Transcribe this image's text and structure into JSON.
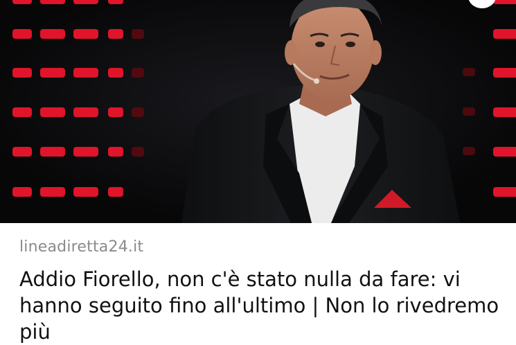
{
  "article": {
    "source": "lineadiretta24.it",
    "headline": "Addio Fiorello, non c'è stato nulla da fare: vi hanno seguito fino all'ultimo | Non lo rivedremo più"
  },
  "image": {
    "subject": "photo-of-presenter-on-stage",
    "colors": {
      "background": "#0b0b0d",
      "led_red": "#e0142a",
      "jacket": "#161719",
      "shirt": "#ececec",
      "pocket_square": "#d01a28"
    }
  }
}
